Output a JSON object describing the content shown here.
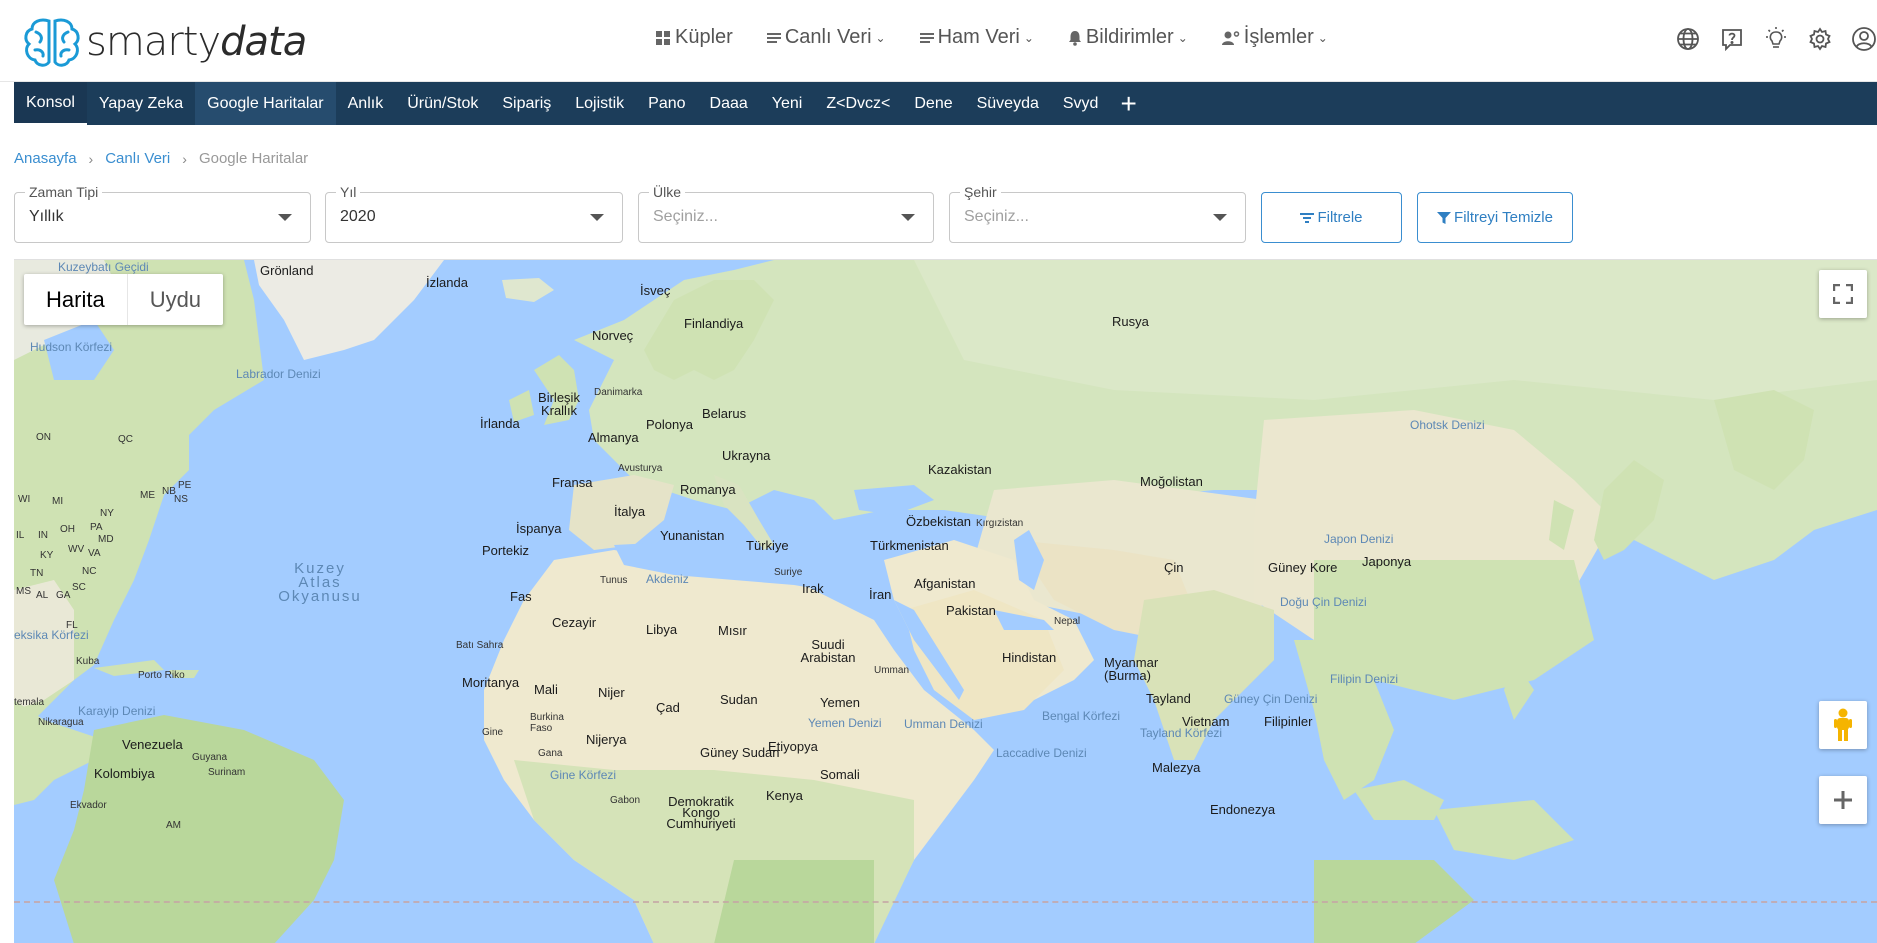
{
  "brand": {
    "name_a": "smarty",
    "name_b": "data"
  },
  "top_nav": [
    {
      "label": "Küpler",
      "icon": "cubes-icon",
      "dropdown": false
    },
    {
      "label": "Canlı Veri",
      "icon": "list-icon",
      "dropdown": true
    },
    {
      "label": "Ham Veri",
      "icon": "list-icon",
      "dropdown": true
    },
    {
      "label": "Bildirimler",
      "icon": "bell-icon",
      "dropdown": true
    },
    {
      "label": "İşlemler",
      "icon": "user-gear-icon",
      "dropdown": true
    }
  ],
  "top_icons": [
    "globe-icon",
    "help-icon",
    "lightbulb-icon",
    "settings-icon",
    "account-icon"
  ],
  "tabs": [
    "Konsol",
    "Yapay Zeka",
    "Google Haritalar",
    "Anlık",
    "Ürün/Stok",
    "Sipariş",
    "Lojistik",
    "Pano",
    "Daaa",
    "Yeni",
    "Z<Dvcz<",
    "Dene",
    "Süveyda",
    "Svyd"
  ],
  "active_tab": "Konsol",
  "selected_tab": "Google Haritalar",
  "breadcrumb": {
    "home": "Anasayfa",
    "parent": "Canlı Veri",
    "current": "Google Haritalar"
  },
  "filters": {
    "zaman_tipi": {
      "label": "Zaman Tipi",
      "value": "Yıllık"
    },
    "yil": {
      "label": "Yıl",
      "value": "2020"
    },
    "ulke": {
      "label": "Ülke",
      "placeholder": "Seçiniz..."
    },
    "sehir": {
      "label": "Şehir",
      "placeholder": "Seçiniz..."
    },
    "filter_btn": "Filtrele",
    "clear_btn": "Filtreyi Temizle"
  },
  "map": {
    "type_buttons": {
      "map": "Harita",
      "satellite": "Uydu"
    },
    "labels": {
      "gronland": "Grönland",
      "izlanda": "İzlanda",
      "isvec": "İsveç",
      "finlandiya": "Finlandiya",
      "norvec": "Norveç",
      "rusya": "Rusya",
      "hudson": "Hudson Körfezi",
      "labrador": "Labrador Denizi",
      "danimarka": "Danimarka",
      "birlesik": "Birleşik Krallık",
      "irlanda": "İrlanda",
      "polonya": "Polonya",
      "belarus": "Belarus",
      "almanya": "Almanya",
      "ukrayna": "Ukrayna",
      "avusturya": "Avusturya",
      "fransa": "Fransa",
      "romanya": "Romanya",
      "kazakistan": "Kazakistan",
      "mogolistan": "Moğolistan",
      "ohotsk": "Ohotsk Denizi",
      "italya": "İtalya",
      "ispanya": "İspanya",
      "portekiz": "Portekiz",
      "yunanistan": "Yunanistan",
      "turkiye": "Türkiye",
      "ozbekistan": "Özbekistan",
      "kirgizistan": "Kırgızistan",
      "turkmenistan": "Türkmenistan",
      "japon_denizi": "Japon Denizi",
      "guney_kore": "Güney Kore",
      "japonya": "Japonya",
      "cin": "Çin",
      "kuzey_atlas": "Kuzey Atlas Okyanusu",
      "tunus": "Tunus",
      "akdeniz": "Akdeniz",
      "suriye": "Suriye",
      "irak": "Irak",
      "iran": "İran",
      "afganistan": "Afganistan",
      "pakistan": "Pakistan",
      "fas": "Fas",
      "cezayir": "Cezayir",
      "libya": "Libya",
      "misir": "Mısır",
      "nepal": "Nepal",
      "dogu_cin": "Doğu Çin Denizi",
      "bati_sahra": "Batı Sahra",
      "suudi": "Suudi Arabistan",
      "umman": "Umman",
      "hindistan": "Hindistan",
      "myanmar": "Myanmar (Burma)",
      "kuba": "Kuba",
      "porto_riko": "Porto Riko",
      "moritanya": "Moritanya",
      "mali": "Mali",
      "nijer": "Nijer",
      "filipin_denizi": "Filipin Denizi",
      "cad": "Çad",
      "sudan": "Sudan",
      "yemen": "Yemen",
      "guatemala": "temala",
      "karayip": "Karayip Denizi",
      "nikaragua": "Nikaragua",
      "burkina": "Burkina Faso",
      "bengal": "Bengal Körfezi",
      "tayland": "Tayland",
      "guney_cin": "Güney Çin Denizi",
      "venezuela": "Venezuela",
      "gine": "Gine",
      "nijerya": "Nijerya",
      "yemen_denizi": "Yemen Denizi",
      "umman_denizi": "Umman Denizi",
      "vietnam": "Vietnam",
      "filipinler": "Filipinler",
      "guyana": "Guyana",
      "gana": "Gana",
      "guney_sudan": "Güney Sudan",
      "etiyopya": "Etiyopya",
      "tayland_korfezi": "Tayland Körfezi",
      "surinam": "Surinam",
      "lakkadiv": "Laccadive Denizi",
      "kolombiya": "Kolombiya",
      "gine_korfezi": "Gine Körfezi",
      "somali": "Somali",
      "malezya": "Malezya",
      "kenya": "Kenya",
      "ekvador": "Ekvador",
      "gabon": "Gabon",
      "demokratik": "Demokratik Kongo Cumhuriyeti",
      "endonezya": "Endonezya",
      "eksika": "eksika Körfezi",
      "kuzeybati": "Kuzeybatı Geçidi",
      "on": "ON",
      "qc": "QC",
      "nb": "NB",
      "pe": "PE",
      "ns": "NS",
      "me": "ME",
      "wi": "WI",
      "mi": "MI",
      "ny": "NY",
      "pa": "PA",
      "md": "MD",
      "il": "IL",
      "in": "IN",
      "oh": "OH",
      "wv": "WV",
      "va": "VA",
      "ky": "KY",
      "nc": "NC",
      "tn": "TN",
      "sc": "SC",
      "ms": "MS",
      "al": "AL",
      "ga": "GA",
      "fl": "FL",
      "am": "AM"
    }
  }
}
